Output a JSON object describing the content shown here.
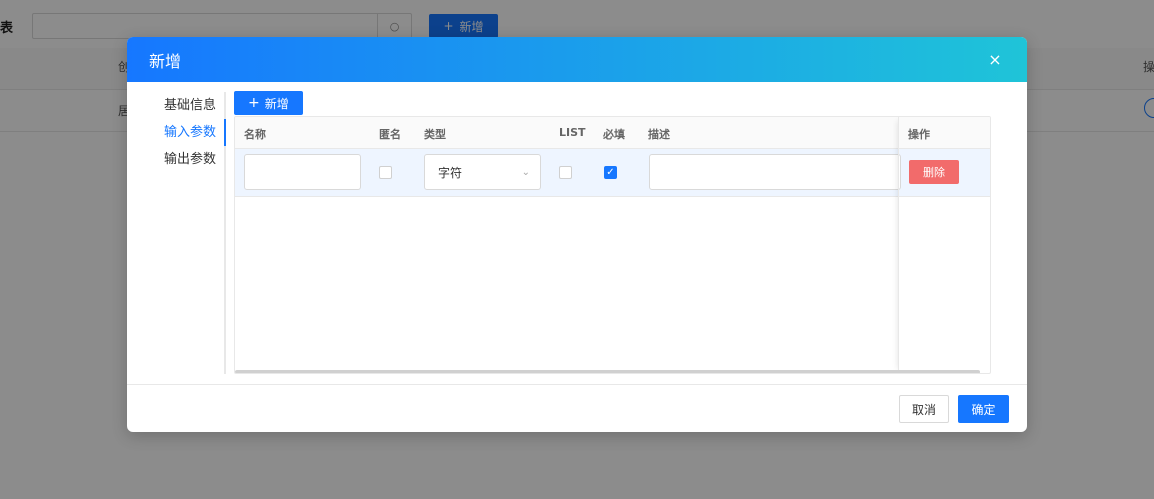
{
  "background": {
    "title": "表",
    "add_label": "新增",
    "header_col1": "创",
    "header_col2": "操",
    "row_col1": "居"
  },
  "modal": {
    "title": "新增",
    "close_icon": "×",
    "nav": [
      "基础信息",
      "输入参数",
      "输出参数"
    ],
    "add_label": "新增",
    "table": {
      "columns": [
        "名称",
        "匿名",
        "类型",
        "LIST",
        "必填",
        "描述",
        "操作"
      ],
      "row": {
        "name_value": "",
        "anonymous_checked": false,
        "type_value": "字符",
        "list_checked": false,
        "required_checked": true,
        "desc_value": "",
        "delete_label": "删除"
      }
    },
    "footer": {
      "cancel_label": "取消",
      "ok_label": "确定"
    }
  },
  "colors": {
    "primary": "#1677ff",
    "header_gradient_end": "#1fc4d8",
    "danger": "#f26b6b"
  }
}
